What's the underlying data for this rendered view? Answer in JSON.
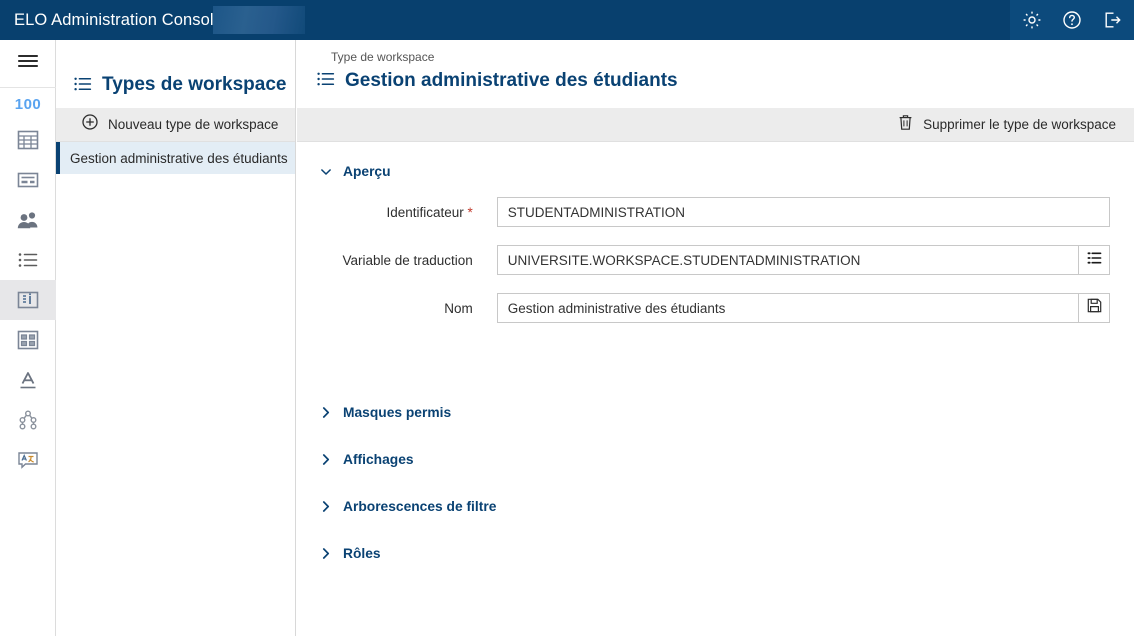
{
  "titlebar": {
    "app_title": "ELO Administration Console",
    "redacted": true,
    "actions": [
      {
        "name": "settings-icon",
        "label": "Paramètres"
      },
      {
        "name": "help-icon",
        "label": "Aide"
      },
      {
        "name": "logout-icon",
        "label": "Déconnexion"
      }
    ],
    "bg_color": "#08406e"
  },
  "rail": {
    "menu_label": "Menu",
    "count": "100",
    "items": [
      {
        "name": "table-icon",
        "label": "Masques",
        "selected": false
      },
      {
        "name": "card-icon",
        "label": "Formulaires",
        "selected": false
      },
      {
        "name": "users-icon",
        "label": "Utilisateurs et groupes",
        "selected": false
      },
      {
        "name": "list-icon",
        "label": "Mots-clés",
        "selected": false
      },
      {
        "name": "workspace-types-icon",
        "label": "Types de workspace",
        "selected": true
      },
      {
        "name": "layout-icon",
        "label": "Affichages",
        "selected": false
      },
      {
        "name": "text-icon",
        "label": "Textes",
        "selected": false
      },
      {
        "name": "hierarchy-icon",
        "label": "Organisation",
        "selected": false
      },
      {
        "name": "translation-icon",
        "label": "Traductions",
        "selected": false
      }
    ]
  },
  "middle": {
    "title": "Types de workspace",
    "new_label": "Nouveau type de workspace",
    "list": [
      {
        "label": "Gestion administrative des étudiants",
        "selected": true
      }
    ]
  },
  "right": {
    "breadcrumb": "Type de workspace",
    "title": "Gestion administrative des étudiants",
    "delete_label": "Supprimer le type de workspace",
    "overview": {
      "section_title": "Aperçu",
      "expanded": true,
      "fields": [
        {
          "label": "Identificateur",
          "required": true,
          "value": "STUDENTADMINISTRATION",
          "placeholder": "",
          "button": null
        },
        {
          "label": "Variable de traduction",
          "required": false,
          "value": "UNIVERSITE.WORKSPACE.STUDENTADMINISTRATION",
          "placeholder": "",
          "button": "list-icon"
        },
        {
          "label": "Nom",
          "required": false,
          "value": "Gestion administrative des étudiants",
          "placeholder": "",
          "button": "save-icon"
        }
      ]
    },
    "collapsed_sections": [
      {
        "title": "Masques permis"
      },
      {
        "title": "Affichages"
      },
      {
        "title": "Arborescences de filtre"
      },
      {
        "title": "Rôles"
      }
    ]
  },
  "colors": {
    "brand_dark": "#08406e",
    "brand_title": "#0a4273",
    "accent_blue": "#5aa4f0",
    "selected_row": "#e3edf5",
    "toolbar_grey": "#ececec",
    "required_red": "#c0392b"
  }
}
